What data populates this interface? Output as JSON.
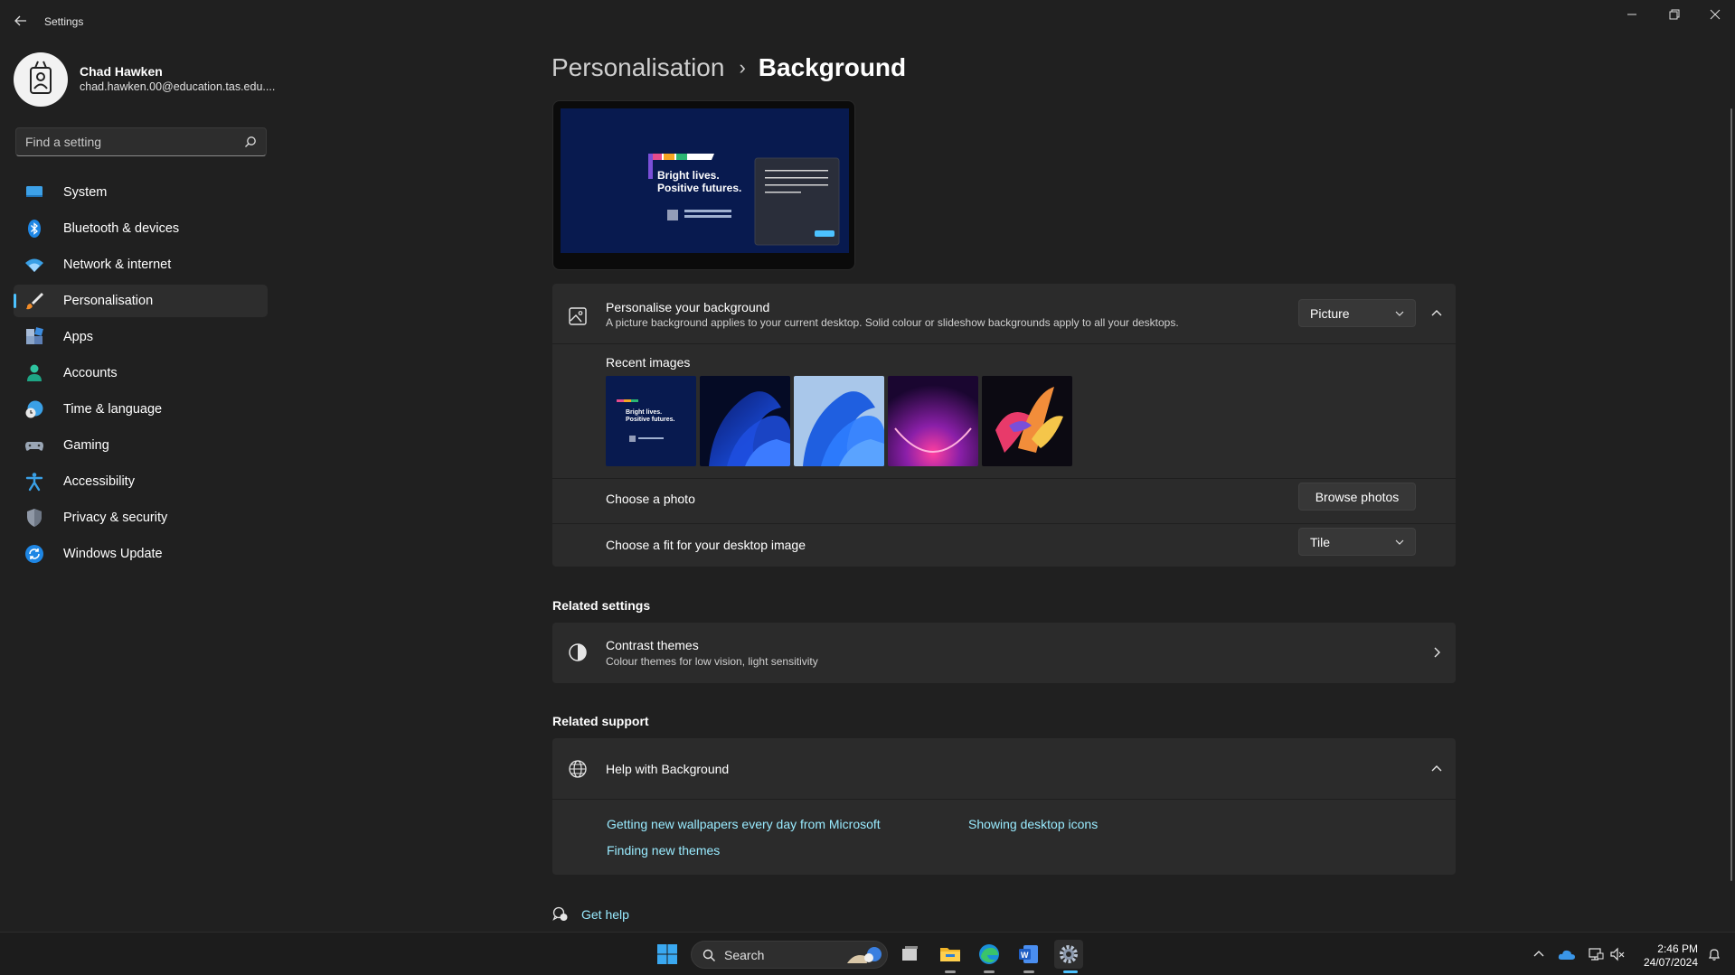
{
  "window": {
    "title": "Settings"
  },
  "profile": {
    "name": "Chad Hawken",
    "email": "chad.hawken.00@education.tas.edu...."
  },
  "search": {
    "placeholder": "Find a setting"
  },
  "sidebar": {
    "items": [
      {
        "label": "System",
        "icon": "system-icon"
      },
      {
        "label": "Bluetooth & devices",
        "icon": "bluetooth-icon"
      },
      {
        "label": "Network & internet",
        "icon": "wifi-icon"
      },
      {
        "label": "Personalisation",
        "icon": "brush-icon",
        "active": true
      },
      {
        "label": "Apps",
        "icon": "apps-icon"
      },
      {
        "label": "Accounts",
        "icon": "person-icon"
      },
      {
        "label": "Time & language",
        "icon": "clock-globe-icon"
      },
      {
        "label": "Gaming",
        "icon": "gamepad-icon"
      },
      {
        "label": "Accessibility",
        "icon": "accessibility-icon"
      },
      {
        "label": "Privacy & security",
        "icon": "shield-icon"
      },
      {
        "label": "Windows Update",
        "icon": "update-icon"
      }
    ]
  },
  "breadcrumb": {
    "parent": "Personalisation",
    "separator": "›",
    "current": "Background"
  },
  "preview": {
    "line1": "Bright lives.",
    "line2": "Positive futures."
  },
  "background": {
    "title": "Personalise your background",
    "description": "A picture background applies to your current desktop. Solid colour or slideshow backgrounds apply to all your desktops.",
    "type_value": "Picture",
    "recent_label": "Recent images",
    "choose_photo_label": "Choose a photo",
    "browse_button": "Browse photos",
    "fit_label": "Choose a fit for your desktop image",
    "fit_value": "Tile"
  },
  "related_settings": {
    "heading": "Related settings",
    "contrast_title": "Contrast themes",
    "contrast_desc": "Colour themes for low vision, light sensitivity"
  },
  "related_support": {
    "heading": "Related support",
    "help_title": "Help with Background",
    "links": [
      "Getting new wallpapers every day from Microsoft",
      "Showing desktop icons",
      "Finding new themes"
    ]
  },
  "get_help": "Get help",
  "taskbar": {
    "search_label": "Search",
    "time": "2:46 PM",
    "date": "24/07/2024"
  },
  "colors": {
    "accent": "#4cc2ff",
    "link": "#99ebff",
    "background": "#202020",
    "card": "#2b2b2b"
  }
}
